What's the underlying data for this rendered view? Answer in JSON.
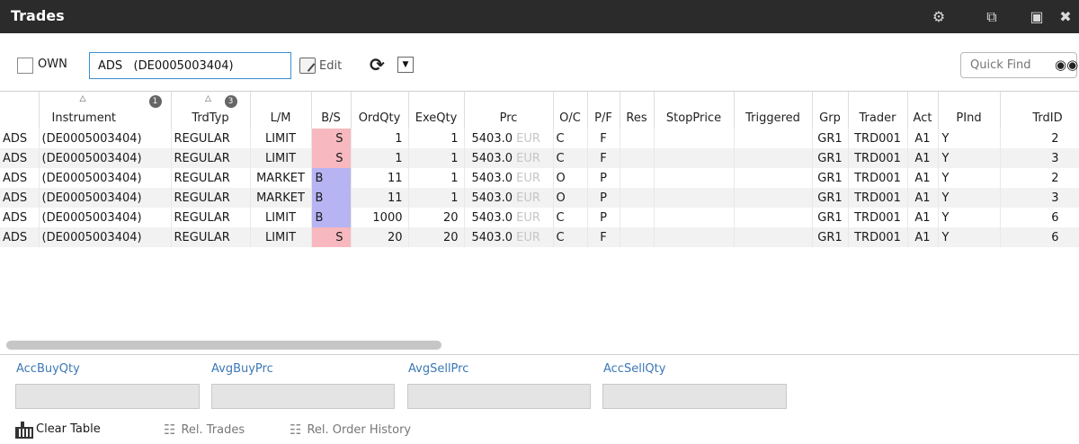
{
  "window": {
    "title": "Trades",
    "icons": [
      "gear-icon",
      "detach-icon",
      "maximize-icon",
      "close-icon"
    ]
  },
  "toolbar": {
    "own_label": "OWN",
    "own_checked": false,
    "instrument_value": "ADS   (DE0005003404)",
    "edit_label": "Edit",
    "quickfind_placeholder": "Quick Find"
  },
  "table": {
    "columns": [
      {
        "key": "sym",
        "label": ""
      },
      {
        "key": "instrument",
        "label": "Instrument",
        "sort": "asc",
        "sort_order": "1"
      },
      {
        "key": "trdtyp",
        "label": "TrdTyp",
        "sort": "asc",
        "sort_order": "3"
      },
      {
        "key": "lm",
        "label": "L/M"
      },
      {
        "key": "bs",
        "label": "B/S"
      },
      {
        "key": "ordqty",
        "label": "OrdQty"
      },
      {
        "key": "exeqty",
        "label": "ExeQty"
      },
      {
        "key": "prc",
        "label": "Prc"
      },
      {
        "key": "oc",
        "label": "O/C"
      },
      {
        "key": "pf",
        "label": "P/F"
      },
      {
        "key": "res",
        "label": "Res"
      },
      {
        "key": "stopprice",
        "label": "StopPrice"
      },
      {
        "key": "triggered",
        "label": "Triggered"
      },
      {
        "key": "grp",
        "label": "Grp"
      },
      {
        "key": "trader",
        "label": "Trader"
      },
      {
        "key": "act",
        "label": "Act"
      },
      {
        "key": "pind",
        "label": "PInd"
      },
      {
        "key": "trdid",
        "label": "TrdID"
      }
    ],
    "rows": [
      {
        "sym": "ADS",
        "isin": "(DE0005003404)",
        "trdtyp": "REGULAR",
        "lm": "LIMIT",
        "bs": "S",
        "ordqty": "1",
        "exeqty": "1",
        "prc": "5403.0",
        "cur": "EUR",
        "oc": "C",
        "pf": "F",
        "res": "",
        "stopprice": "",
        "triggered": "",
        "grp": "GR1",
        "trader": "TRD001",
        "act": "A1",
        "pind": "Y",
        "trdid": "2"
      },
      {
        "sym": "ADS",
        "isin": "(DE0005003404)",
        "trdtyp": "REGULAR",
        "lm": "LIMIT",
        "bs": "S",
        "ordqty": "1",
        "exeqty": "1",
        "prc": "5403.0",
        "cur": "EUR",
        "oc": "C",
        "pf": "F",
        "res": "",
        "stopprice": "",
        "triggered": "",
        "grp": "GR1",
        "trader": "TRD001",
        "act": "A1",
        "pind": "Y",
        "trdid": "3"
      },
      {
        "sym": "ADS",
        "isin": "(DE0005003404)",
        "trdtyp": "REGULAR",
        "lm": "MARKET",
        "bs": "B",
        "ordqty": "11",
        "exeqty": "1",
        "prc": "5403.0",
        "cur": "EUR",
        "oc": "O",
        "pf": "P",
        "res": "",
        "stopprice": "",
        "triggered": "",
        "grp": "GR1",
        "trader": "TRD001",
        "act": "A1",
        "pind": "Y",
        "trdid": "2"
      },
      {
        "sym": "ADS",
        "isin": "(DE0005003404)",
        "trdtyp": "REGULAR",
        "lm": "MARKET",
        "bs": "B",
        "ordqty": "11",
        "exeqty": "1",
        "prc": "5403.0",
        "cur": "EUR",
        "oc": "O",
        "pf": "P",
        "res": "",
        "stopprice": "",
        "triggered": "",
        "grp": "GR1",
        "trader": "TRD001",
        "act": "A1",
        "pind": "Y",
        "trdid": "3"
      },
      {
        "sym": "ADS",
        "isin": "(DE0005003404)",
        "trdtyp": "REGULAR",
        "lm": "LIMIT",
        "bs": "B",
        "ordqty": "1000",
        "exeqty": "20",
        "prc": "5403.0",
        "cur": "EUR",
        "oc": "C",
        "pf": "P",
        "res": "",
        "stopprice": "",
        "triggered": "",
        "grp": "GR1",
        "trader": "TRD001",
        "act": "A1",
        "pind": "Y",
        "trdid": "6"
      },
      {
        "sym": "ADS",
        "isin": "(DE0005003404)",
        "trdtyp": "REGULAR",
        "lm": "LIMIT",
        "bs": "S",
        "ordqty": "20",
        "exeqty": "20",
        "prc": "5403.0",
        "cur": "EUR",
        "oc": "C",
        "pf": "F",
        "res": "",
        "stopprice": "",
        "triggered": "",
        "grp": "GR1",
        "trader": "TRD001",
        "act": "A1",
        "pind": "Y",
        "trdid": "6"
      }
    ]
  },
  "summary": {
    "acc_buy_qty_label": "AccBuyQty",
    "avg_buy_prc_label": "AvgBuyPrc",
    "avg_sell_prc_label": "AvgSellPrc",
    "acc_sell_qty_label": "AccSellQty",
    "acc_buy_qty_value": "",
    "avg_buy_prc_value": "",
    "avg_sell_prc_value": "",
    "acc_sell_qty_value": ""
  },
  "bottom": {
    "clear_table": "Clear Table",
    "rel_trades": "Rel. Trades",
    "rel_order_history": "Rel. Order History"
  },
  "colors": {
    "title_bar": "#2b2b2b",
    "sell": "#f7b8bf",
    "buy": "#b7b4f3",
    "summary_label": "#3c78b4",
    "input_border": "#3c8fd0"
  }
}
